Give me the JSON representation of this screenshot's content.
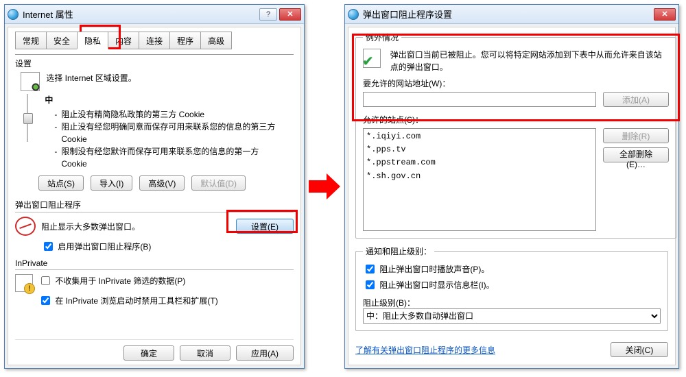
{
  "left": {
    "title": "Internet 属性",
    "tabs": [
      "常规",
      "安全",
      "隐私",
      "内容",
      "连接",
      "程序",
      "高级"
    ],
    "active_tab_index": 2,
    "settings": {
      "heading": "设置",
      "selectZone": "选择 Internet 区域设置。",
      "level": "中",
      "bullets": [
        "阻止没有精简隐私政策的第三方 Cookie",
        "阻止没有经您明确同意而保存可用来联系您的信息的第三方 Cookie",
        "限制没有经您默许而保存可用来联系您的信息的第一方 Cookie"
      ],
      "buttons": {
        "sites": "站点(S)",
        "import": "导入(I)",
        "advanced": "高级(V)",
        "default": "默认值(D)"
      }
    },
    "popup": {
      "heading": "弹出窗口阻止程序",
      "desc": "阻止显示大多数弹出窗口。",
      "settingsBtn": "设置(E)",
      "enableLabel": "启用弹出窗口阻止程序(B)",
      "enableChecked": true
    },
    "inprivate": {
      "heading": "InPrivate",
      "collectLabel": "不收集用于 InPrivate 筛选的数据(P)",
      "collectChecked": false,
      "disableExtLabel": "在 InPrivate 浏览启动时禁用工具栏和扩展(T)",
      "disableExtChecked": true
    },
    "footer": {
      "ok": "确定",
      "cancel": "取消",
      "apply": "应用(A)"
    }
  },
  "right": {
    "title": "弹出窗口阻止程序设置",
    "exceptions": {
      "legend": "例外情况",
      "desc": "弹出窗口当前已被阻止。您可以将特定网站添加到下表中从而允许来自该站点的弹出窗口。",
      "addressLabel": "要允许的网站地址(W)：",
      "addressValue": "",
      "addBtn": "添加(A)",
      "allowedLabel": "允许的站点(S)：",
      "sites": [
        "*.iqiyi.com",
        "*.pps.tv",
        "*.ppstream.com",
        "*.sh.gov.cn"
      ],
      "removeBtn": "删除(R)",
      "removeAllBtn": "全部删除(E)…"
    },
    "notify": {
      "legend": "通知和阻止级别：",
      "soundLabel": "阻止弹出窗口时播放声音(P)。",
      "soundChecked": true,
      "infobarLabel": "阻止弹出窗口时显示信息栏(I)。",
      "infobarChecked": true,
      "levelLabel": "阻止级别(B)：",
      "levelValue": "中：阻止大多数自动弹出窗口"
    },
    "learnMore": "了解有关弹出窗口阻止程序的更多信息",
    "close": "关闭(C)"
  }
}
